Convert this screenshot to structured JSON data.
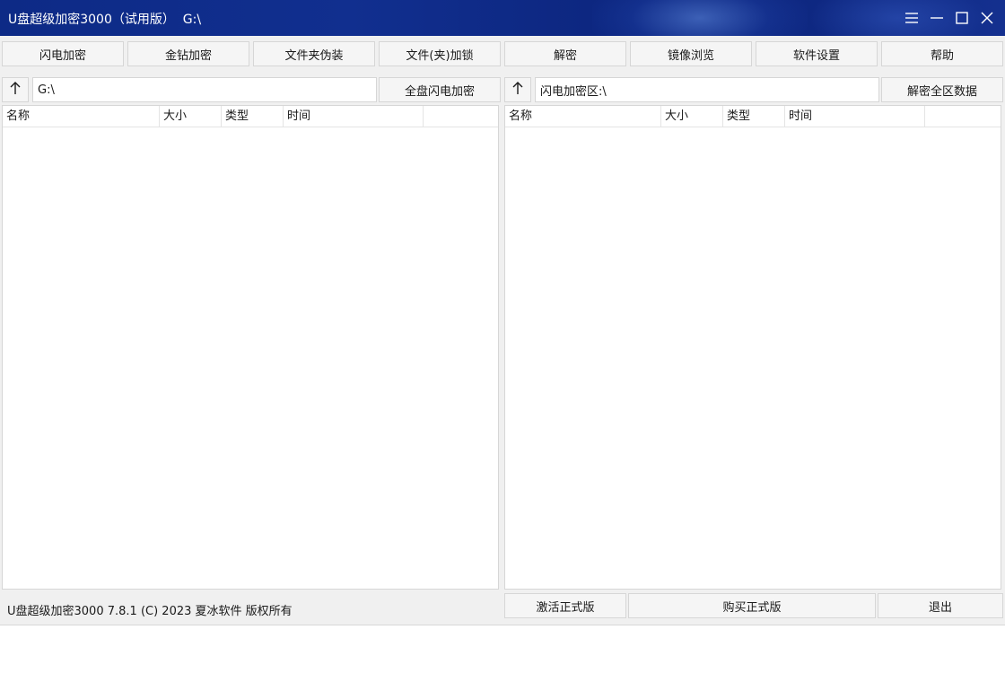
{
  "titlebar": {
    "title": "U盘超级加密3000（试用版）  G:\\"
  },
  "toolbar": {
    "buttons": [
      {
        "label": "闪电加密"
      },
      {
        "label": "金钻加密"
      },
      {
        "label": "文件夹伪装"
      },
      {
        "label": "文件(夹)加锁"
      },
      {
        "label": "解密"
      },
      {
        "label": "镜像浏览"
      },
      {
        "label": "软件设置"
      },
      {
        "label": "帮助"
      }
    ]
  },
  "left_pane": {
    "path": "G:\\",
    "action_label": "全盘闪电加密",
    "columns": [
      "名称",
      "大小",
      "类型",
      "时间",
      ""
    ]
  },
  "right_pane": {
    "path": "闪电加密区:\\",
    "action_label": "解密全区数据",
    "columns": [
      "名称",
      "大小",
      "类型",
      "时间",
      ""
    ]
  },
  "footer": {
    "status": "U盘超级加密3000 7.8.1 (C) 2023 夏冰软件 版权所有",
    "activate_label": "激活正式版",
    "buy_label": "购买正式版",
    "exit_label": "退出"
  },
  "icons": {
    "up_arrow": "up-arrow-icon",
    "menu": "menu-icon",
    "minimize": "minimize-icon",
    "maximize": "maximize-icon",
    "close": "close-icon"
  },
  "colors": {
    "titlebar": "#0d2a86",
    "window_bg": "#f0f0f0",
    "button_bg": "#f5f5f5",
    "border": "#d6d6d6"
  }
}
